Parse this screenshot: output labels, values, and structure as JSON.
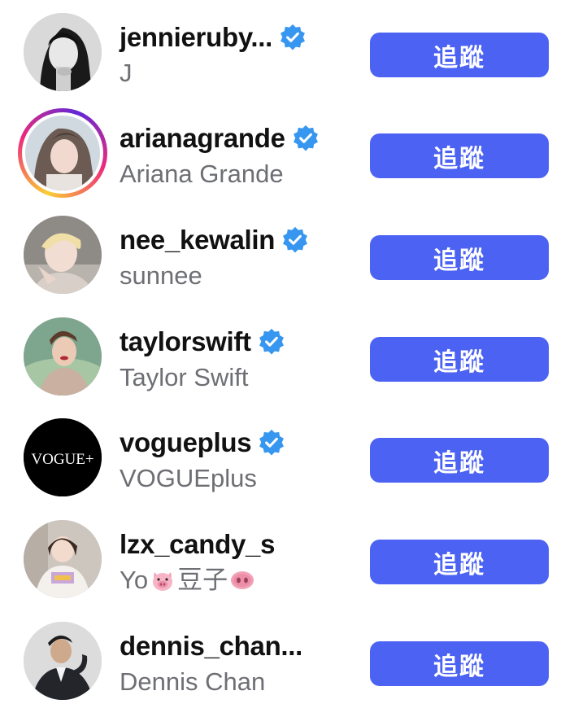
{
  "follow_label": "追蹤",
  "accounts": [
    {
      "username": "jennieruby...",
      "full_name": "J",
      "verified": true,
      "avatar": "jennie-avatar"
    },
    {
      "username": "arianagrande",
      "full_name": "Ariana Grande",
      "verified": true,
      "avatar": "ariana-avatar",
      "story_ring": true
    },
    {
      "username": "nee_kewalin",
      "full_name": "sunnee",
      "verified": true,
      "avatar": "sunnee-avatar"
    },
    {
      "username": "taylorswift",
      "full_name": "Taylor Swift",
      "verified": true,
      "avatar": "taylor-avatar"
    },
    {
      "username": "vogueplus",
      "full_name": "VOGUEplus",
      "verified": true,
      "avatar": "vogue-logo-avatar",
      "avatar_text": "VOGUE+"
    },
    {
      "username": "lzx_candy_s",
      "full_name_parts": [
        "Yo",
        "豆子"
      ],
      "verified": false,
      "avatar": "candy-avatar",
      "emoji": "pig-face-icon"
    },
    {
      "username": "dennis_chan...",
      "full_name": "Dennis Chan",
      "verified": false,
      "avatar": "dennis-avatar"
    }
  ],
  "colors": {
    "follow_button": "#4b62f3",
    "verified_badge": "#3797f0",
    "secondary_text": "#6e6f74"
  }
}
